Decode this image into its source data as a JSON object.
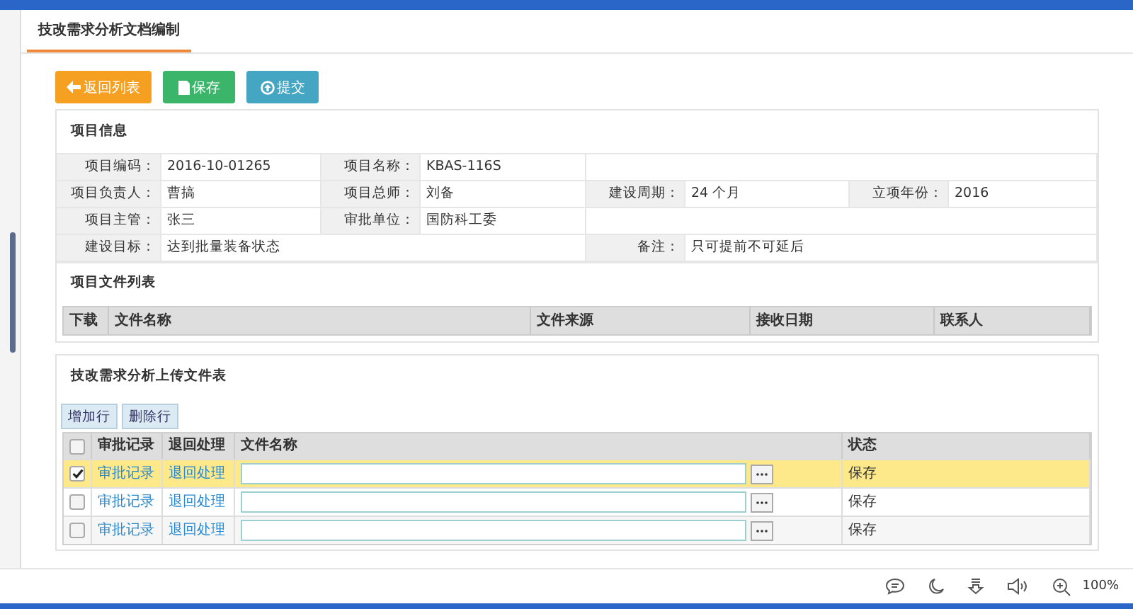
{
  "tabs": [
    {
      "label": "技改需求分析文档编制",
      "selected": true
    }
  ],
  "actions": [
    {
      "kind": "back",
      "label": "返回列表"
    },
    {
      "kind": "save",
      "label": "保存"
    },
    {
      "kind": "submit",
      "label": "提交"
    }
  ],
  "info": {
    "title": "项目信息",
    "rows": [
      {
        "kind": "normal",
        "fields": [
          {
            "label": "项目编码：",
            "value": "2016-10-01265"
          },
          {
            "label": "项目名称：",
            "value": "KBAS-116S"
          }
        ]
      },
      {
        "kind": "normal",
        "fields": [
          {
            "label": "项目负责人：",
            "value": "曹搞"
          },
          {
            "label": "项目总师：",
            "value": "刘备"
          },
          {
            "label": "建设周期：",
            "value": "24 个月"
          },
          {
            "label": "立项年份：",
            "value": "2016"
          }
        ]
      },
      {
        "kind": "normal",
        "fields": [
          {
            "label": "项目主管：",
            "value": "张三"
          },
          {
            "label": "审批单位：",
            "value": "国防科工委"
          }
        ]
      },
      {
        "kind": "wide",
        "fields": [
          {
            "label": "建设目标：",
            "value": "达到批量装备状态"
          },
          {
            "label": "备注：",
            "value": "只可提前不可延后"
          }
        ]
      }
    ]
  },
  "files": {
    "title": "项目文件列表",
    "columns": [
      "下载",
      "文件名称",
      "文件来源",
      "接收日期",
      "联系人"
    ]
  },
  "upload": {
    "title": "技改需求分析上传文件表",
    "all_selected": false,
    "buttons": [
      "增加行",
      "删除行"
    ],
    "columns": [
      "审批记录",
      "退回处理",
      "文件名称",
      "状态"
    ],
    "rows": [
      {
        "selected": true,
        "record": "审批记录",
        "return": "退回处理",
        "status": "保存"
      },
      {
        "selected": false,
        "record": "审批记录",
        "return": "退回处理",
        "status": "保存"
      },
      {
        "selected": false,
        "record": "审批记录",
        "return": "退回处理",
        "status": "保存"
      }
    ]
  },
  "status_bar": {
    "zoom": "100%"
  }
}
